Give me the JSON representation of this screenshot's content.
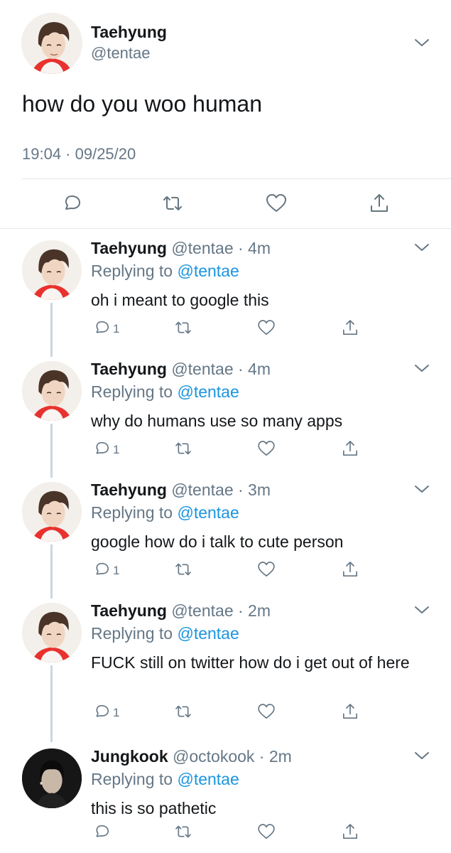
{
  "colors": {
    "text": "#14171a",
    "secondary": "#657786",
    "link": "#1b95e0",
    "divider": "#e1e8ed",
    "thread_line": "#ccd6dd"
  },
  "main_tweet": {
    "author_name": "Taehyung",
    "author_handle": "@tentae",
    "text": "how do you woo human",
    "timestamp": "19:04 · 09/25/20",
    "icons": [
      "reply-icon",
      "retweet-icon",
      "like-icon",
      "share-icon",
      "chevron-down-icon"
    ]
  },
  "replies": [
    {
      "name": "Taehyung",
      "meta": "@tentae · 4m",
      "replying_prefix": "Replying to ",
      "replying_to": "@tentae",
      "text": "oh i meant to google this",
      "reply_count": "1"
    },
    {
      "name": "Taehyung",
      "meta": "@tentae · 4m",
      "replying_prefix": "Replying to ",
      "replying_to": "@tentae",
      "text": "why do humans use so many apps",
      "reply_count": "1"
    },
    {
      "name": "Taehyung",
      "meta": "@tentae · 3m",
      "replying_prefix": "Replying to ",
      "replying_to": "@tentae",
      "text": "google how do i talk to cute person",
      "reply_count": "1"
    },
    {
      "name": "Taehyung",
      "meta": "@tentae · 2m",
      "replying_prefix": "Replying to ",
      "replying_to": "@tentae",
      "text": "FUCK still on twitter how do i get out of here",
      "reply_count": "1"
    },
    {
      "name": "Jungkook",
      "meta": "@octokook · 2m",
      "replying_prefix": "Replying to ",
      "replying_to": "@tentae",
      "text": "this is so pathetic",
      "reply_count": ""
    }
  ]
}
